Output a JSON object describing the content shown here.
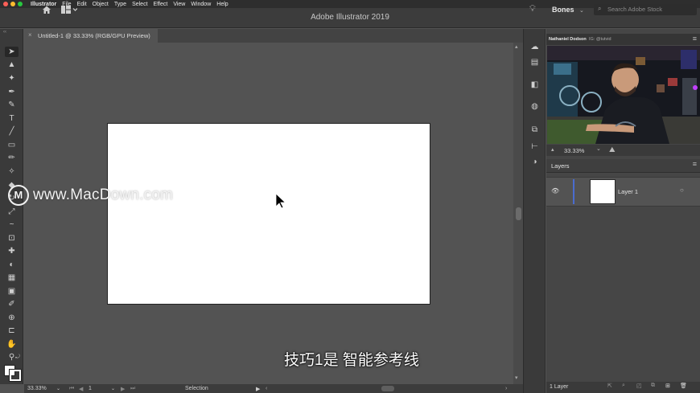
{
  "menubar": {
    "app_name": "Illustrator",
    "items": [
      "File",
      "Edit",
      "Object",
      "Type",
      "Select",
      "Effect",
      "View",
      "Window",
      "Help"
    ]
  },
  "appbar": {
    "title": "Adobe Illustrator 2019",
    "workspace": "Bones",
    "search_placeholder": "Search Adobe Stock"
  },
  "document": {
    "tab_label": "Untitled-1 @ 33.33% (RGB/GPU Preview)",
    "close_glyph": "×"
  },
  "toolbar": {
    "tools": [
      "selection-tool",
      "direct-selection-tool",
      "magic-wand-tool",
      "pen-tool",
      "curvature-tool",
      "type-tool",
      "line-tool",
      "rectangle-tool",
      "paintbrush-tool",
      "shaper-tool",
      "eraser-tool",
      "rotate-tool",
      "scale-tool",
      "warp-tool",
      "free-transform-tool",
      "puppet-warp-tool",
      "shape-builder-tool",
      "perspective-grid-tool",
      "gradient-tool",
      "eyedropper-tool",
      "blend-tool",
      "artboard-tool",
      "hand-tool",
      "zoom-tool"
    ],
    "glyphs": [
      "➤",
      "▲",
      "✦",
      "✒",
      "✎",
      "T",
      "╱",
      "▭",
      "✏",
      "✧",
      "◆",
      "↻",
      "⤢",
      "~",
      "⊡",
      "✚",
      "◐",
      "▦",
      "▣",
      "✐",
      "⊕",
      "⊏",
      "✋",
      "⚲"
    ]
  },
  "watermark": {
    "text": "www.MacDown.com",
    "logo_letter": "M"
  },
  "subtitle": "技巧1是 智能参考线",
  "statusbar": {
    "zoom": "33.33%",
    "artboard_number": "1",
    "tool_name": "Selection"
  },
  "video": {
    "presenter_name": "Nathaniel Dodson",
    "handle": "IG: @tutvid"
  },
  "navigator": {
    "zoom": "33.33%"
  },
  "layers": {
    "panel_title": "Layers",
    "layer_name": "Layer 1",
    "count_text": "1 Layer"
  },
  "colors": {
    "canvas_bg": "#535353",
    "panel_bg": "#464646",
    "toolbar_bg": "#3a3a3a",
    "layer_color": "#4a6ccf",
    "artboard": "#ffffff"
  }
}
